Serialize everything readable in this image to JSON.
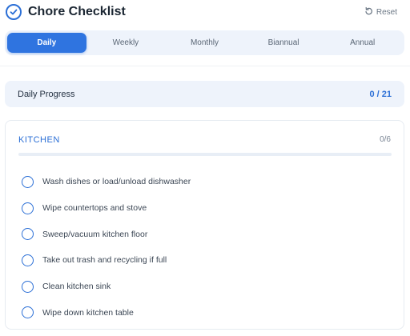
{
  "app": {
    "title": "Chore Checklist",
    "reset_label": "Reset",
    "accent_color": "#2f74e0"
  },
  "tabs": [
    {
      "label": "Daily",
      "active": true
    },
    {
      "label": "Weekly",
      "active": false
    },
    {
      "label": "Monthly",
      "active": false
    },
    {
      "label": "Biannual",
      "active": false
    },
    {
      "label": "Annual",
      "active": false
    }
  ],
  "progress": {
    "label": "Daily Progress",
    "value": "0 / 21"
  },
  "section": {
    "title": "KITCHEN",
    "count": "0/6",
    "progress_fraction": 0,
    "tasks": [
      {
        "label": "Wash dishes or load/unload dishwasher",
        "done": false
      },
      {
        "label": "Wipe countertops and stove",
        "done": false
      },
      {
        "label": "Sweep/vacuum kitchen floor",
        "done": false
      },
      {
        "label": "Take out trash and recycling if full",
        "done": false
      },
      {
        "label": "Clean kitchen sink",
        "done": false
      },
      {
        "label": "Wipe down kitchen table",
        "done": false
      }
    ]
  },
  "icons": {
    "app_icon": "check-circle-icon",
    "reset_icon": "rotate-ccw-icon"
  }
}
